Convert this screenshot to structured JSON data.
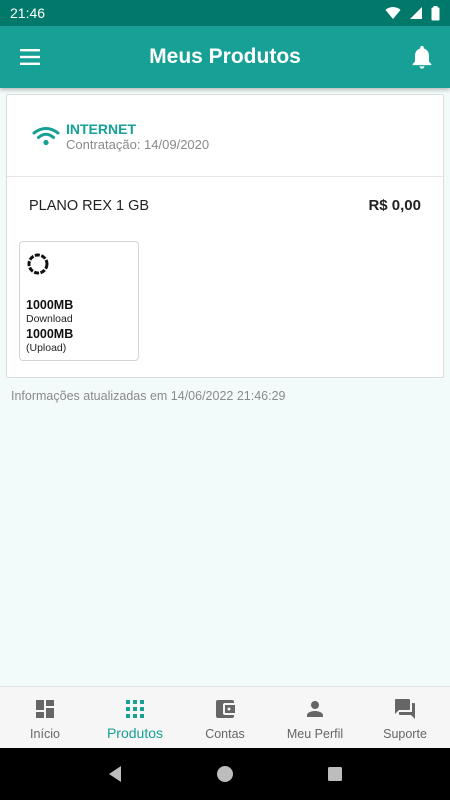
{
  "status": {
    "time": "21:46"
  },
  "appbar": {
    "title": "Meus Produtos"
  },
  "service": {
    "name": "INTERNET",
    "contract_date": "Contratação: 14/09/2020",
    "plan_name": "PLANO REX 1 GB",
    "price": "R$ 0,00",
    "download_value": "1000MB",
    "download_label": "Download",
    "upload_value": "1000MB",
    "upload_label": "(Upload)"
  },
  "updated_text": "Informações atualizadas em 14/06/2022 21:46:29",
  "nav": {
    "items": [
      {
        "label": "Início",
        "icon": "dashboard-icon"
      },
      {
        "label": "Produtos",
        "icon": "grid-icon",
        "active": true
      },
      {
        "label": "Contas",
        "icon": "wallet-icon"
      },
      {
        "label": "Meu Perfil",
        "icon": "person-icon"
      },
      {
        "label": "Suporte",
        "icon": "chat-icon"
      }
    ]
  },
  "colors": {
    "primary": "#16a096",
    "status_bar": "#00796b"
  }
}
